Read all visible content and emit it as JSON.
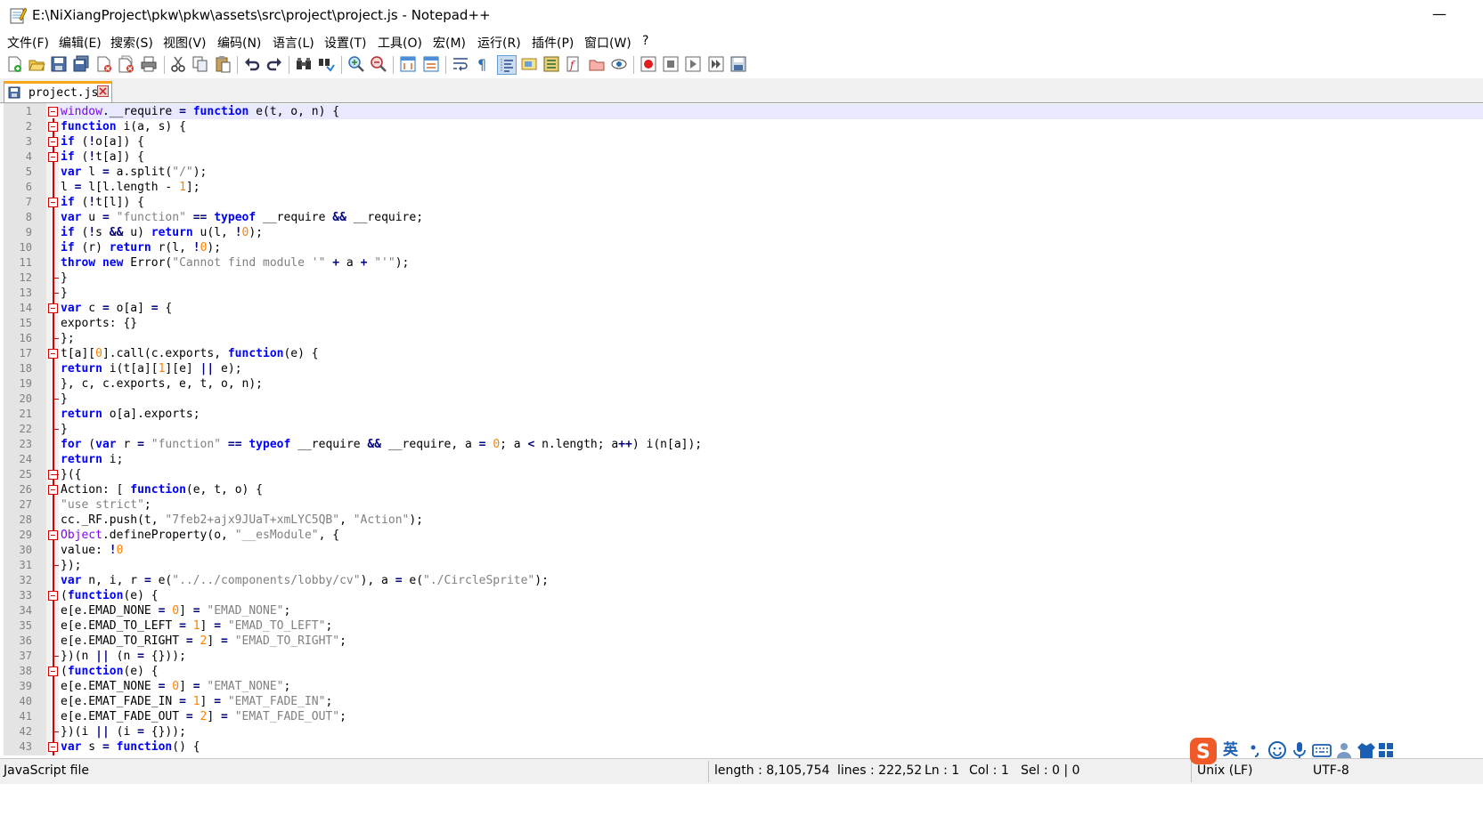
{
  "window": {
    "title": "E:\\NiXiangProject\\pkw\\pkw\\assets\\src\\project\\project.js - Notepad++",
    "minimize_label": "—"
  },
  "menu": [
    {
      "label": "文件(F)"
    },
    {
      "label": "编辑(E)"
    },
    {
      "label": "搜索(S)"
    },
    {
      "label": "视图(V)"
    },
    {
      "label": "编码(N)"
    },
    {
      "label": "语言(L)"
    },
    {
      "label": "设置(T)"
    },
    {
      "label": "工具(O)"
    },
    {
      "label": "宏(M)"
    },
    {
      "label": "运行(R)"
    },
    {
      "label": "插件(P)"
    },
    {
      "label": "窗口(W)"
    },
    {
      "label": "?"
    }
  ],
  "toolbar": {
    "icons": [
      "new-file-icon",
      "open-file-icon",
      "save-icon",
      "save-all-icon",
      "close-icon",
      "close-all-icon",
      "print-icon",
      "cut-icon",
      "copy-icon",
      "paste-icon",
      "undo-icon",
      "redo-icon",
      "find-icon",
      "replace-icon",
      "zoom-in-icon",
      "zoom-out-icon",
      "sync-vertical-icon",
      "sync-horizontal-icon",
      "word-wrap-icon",
      "show-all-chars-icon",
      "indent-guide-icon",
      "document-map-icon",
      "function-list-icon",
      "folder-workspace-icon",
      "monitoring-icon",
      "doc-switcher-icon",
      "macro-record-icon",
      "macro-stop-icon",
      "macro-play-icon",
      "macro-run-multiple-icon",
      "macro-save-icon"
    ]
  },
  "tab": {
    "label": "project.js"
  },
  "colors": {
    "keyword": "#0000ff",
    "string": "#808080",
    "number": "#ff8000",
    "operator": "#000080",
    "fold": "#d80000",
    "current_line": "#e8e8ff",
    "tab_accent": "#f9a51a"
  },
  "editor": {
    "line_numbers": [
      "1",
      "2",
      "3",
      "4",
      "5",
      "6",
      "7",
      "8",
      "9",
      "10",
      "11",
      "12",
      "13",
      "14",
      "15",
      "16",
      "17",
      "18",
      "19",
      "20",
      "21",
      "22",
      "23",
      "24",
      "25",
      "26",
      "27",
      "28",
      "29",
      "30",
      "31",
      "32",
      "33",
      "34",
      "35",
      "36",
      "37",
      "38",
      "39",
      "40",
      "41",
      "42",
      "43"
    ],
    "lines": [
      "window.__require = function e(t, o, n) {",
      "function i(a, s) {",
      "if (!o[a]) {",
      "if (!t[a]) {",
      "var l = a.split(\"/\");",
      "l = l[l.length - 1];",
      "if (!t[l]) {",
      "var u = \"function\" == typeof __require && __require;",
      "if (!s && u) return u(l, !0);",
      "if (r) return r(l, !0);",
      "throw new Error(\"Cannot find module '\" + a + \"'\");",
      "}",
      "}",
      "var c = o[a] = {",
      "exports: {}",
      "};",
      "t[a][0].call(c.exports, function(e) {",
      "return i(t[a][1][e] || e);",
      "}, c, c.exports, e, t, o, n);",
      "}",
      "return o[a].exports;",
      "}",
      "for (var r = \"function\" == typeof __require && __require, a = 0; a < n.length; a++) i(n[a]);",
      "return i;",
      "}({",
      "Action: [ function(e, t, o) {",
      "\"use strict\";",
      "cc._RF.push(t, \"7feb2+ajx9JUaT+xmLYC5QB\", \"Action\");",
      "Object.defineProperty(o, \"__esModule\", {",
      "value: !0",
      "});",
      "var n, i, r = e(\"../../components/lobby/cv\"), a = e(\"./CircleSprite\");",
      "(function(e) {",
      "e[e.EMAD_NONE = 0] = \"EMAD_NONE\";",
      "e[e.EMAD_TO_LEFT = 1] = \"EMAD_TO_LEFT\";",
      "e[e.EMAD_TO_RIGHT = 2] = \"EMAD_TO_RIGHT\";",
      "})(n || (n = {}));",
      "(function(e) {",
      "e[e.EMAT_NONE = 0] = \"EMAT_NONE\";",
      "e[e.EMAT_FADE_IN = 1] = \"EMAT_FADE_IN\";",
      "e[e.EMAT_FADE_OUT = 2] = \"EMAT_FADE_OUT\";",
      "})(i || (i = {}));",
      "var s = function() {"
    ]
  },
  "status": {
    "language": "JavaScript file",
    "length": "length : 8,105,754",
    "lines": "lines : 222,52",
    "ln": "Ln : 1",
    "col": "Col : 1",
    "sel": "Sel : 0 | 0",
    "eol": "Unix (LF)",
    "encoding": "UTF-8"
  },
  "ime": {
    "mode_label": "英",
    "icons": [
      "sogou-logo-icon",
      "punctuation-icon",
      "emoji-icon",
      "microphone-icon",
      "keyboard-icon",
      "user-icon",
      "skin-icon",
      "menu-grid-icon"
    ]
  }
}
